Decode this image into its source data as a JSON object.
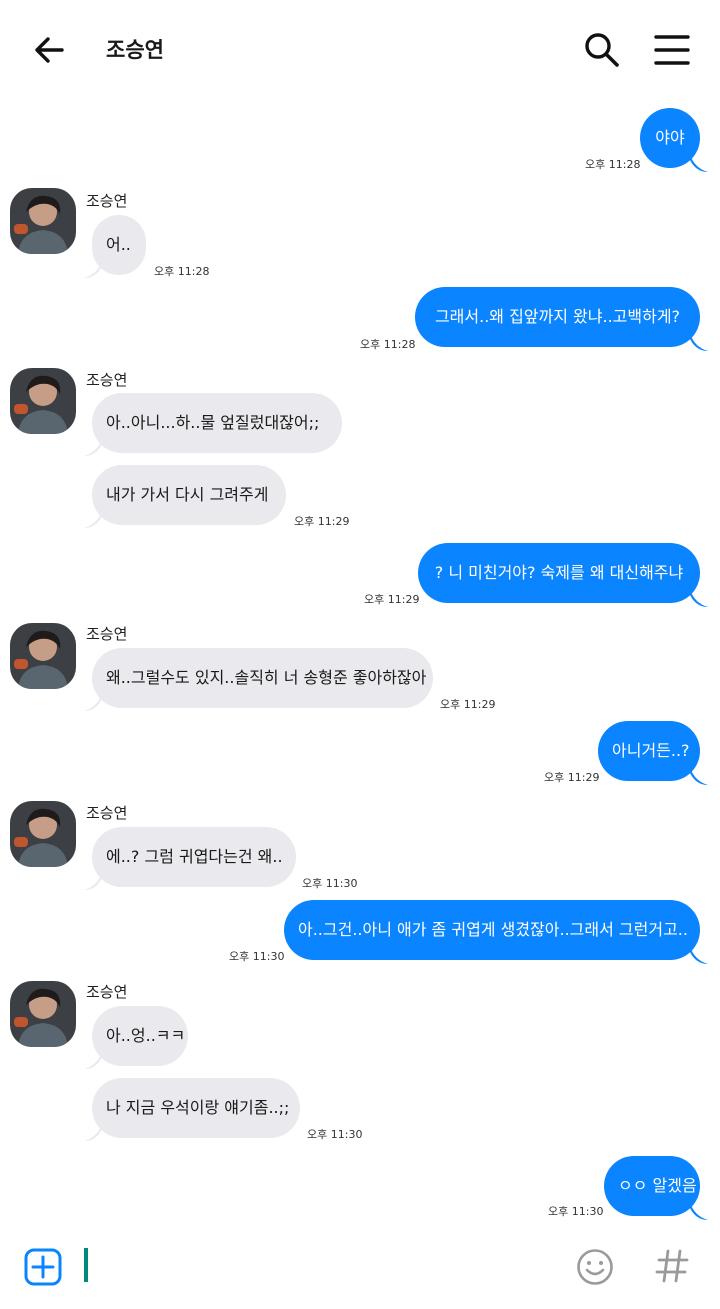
{
  "header": {
    "title": "조승연"
  },
  "colors": {
    "outgoing": "#0a84ff",
    "incoming": "#e9e9ee",
    "cursor": "#008a7e"
  },
  "messages": [
    {
      "side": "out",
      "text": "야야",
      "time": "오후 11:28"
    },
    {
      "side": "in",
      "sender": "조승연",
      "text": "어..",
      "time": "오후 11:28"
    },
    {
      "side": "out",
      "text": "그래서..왜 집앞까지 왔냐..고백하게?",
      "time": "오후 11:28"
    },
    {
      "side": "in",
      "sender": "조승연",
      "text": "아..아니...하..물 엎질렀대잖어;;",
      "time": ""
    },
    {
      "side": "in",
      "text": "내가 가서 다시 그려주게",
      "time": "오후 11:29"
    },
    {
      "side": "out",
      "text": "? 니 미친거야? 숙제를 왜 대신해주냐",
      "time": "오후 11:29"
    },
    {
      "side": "in",
      "sender": "조승연",
      "text": "왜..그럴수도 있지..솔직히 너 송형준 좋아하잖아",
      "time": "오후 11:29"
    },
    {
      "side": "out",
      "text": "아니거든..?",
      "time": "오후 11:29"
    },
    {
      "side": "in",
      "sender": "조승연",
      "text": "에..? 그럼 귀엽다는건 왜..",
      "time": "오후 11:30"
    },
    {
      "side": "out",
      "text": "아..그건..아니 애가 좀 귀엽게 생겼잖아..그래서 그런거고..",
      "time": "오후 11:30"
    },
    {
      "side": "in",
      "sender": "조승연",
      "text": "아..엉..ㅋㅋ",
      "time": ""
    },
    {
      "side": "in",
      "text": "나 지금 우석이랑 얘기좀..;;",
      "time": "오후 11:30"
    },
    {
      "side": "out",
      "text": "ㅇㅇ 알겠음",
      "time": "오후 11:30"
    }
  ]
}
